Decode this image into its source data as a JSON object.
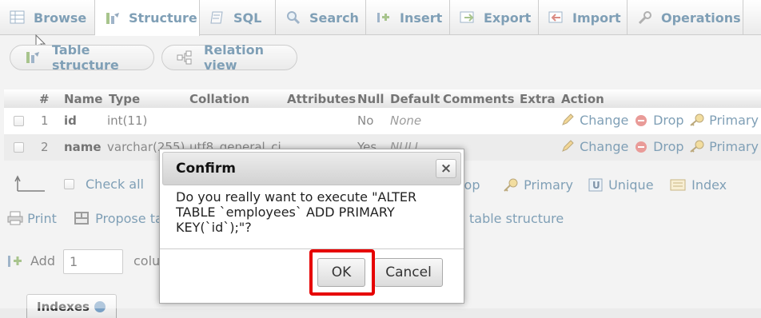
{
  "tabs": [
    {
      "label": "Browse",
      "icon": "browse-icon"
    },
    {
      "label": "Structure",
      "icon": "structure-icon",
      "active": true
    },
    {
      "label": "SQL",
      "icon": "sql-icon"
    },
    {
      "label": "Search",
      "icon": "search-icon"
    },
    {
      "label": "Insert",
      "icon": "insert-icon"
    },
    {
      "label": "Export",
      "icon": "export-icon"
    },
    {
      "label": "Import",
      "icon": "import-icon"
    },
    {
      "label": "Operations",
      "icon": "wrench-icon"
    }
  ],
  "subtabs": {
    "table_structure": "Table structure",
    "relation_view": "Relation view"
  },
  "columns": [
    "#",
    "Name",
    "Type",
    "Collation",
    "Attributes",
    "Null",
    "Default",
    "Comments",
    "Extra",
    "Action"
  ],
  "rows": [
    {
      "num": "1",
      "name": "id",
      "type": "int(11)",
      "collation": "",
      "null": "No",
      "default": "None"
    },
    {
      "num": "2",
      "name": "name",
      "type": "varchar(255)",
      "collation": "utf8_general_ci",
      "null": "Yes",
      "default": "NULL"
    }
  ],
  "row_actions": {
    "change": "Change",
    "drop": "Drop",
    "primary": "Primary"
  },
  "bulk": {
    "check_all": "Check all",
    "drop": "Drop",
    "primary": "Primary",
    "unique": "Unique",
    "index": "Index"
  },
  "bottom_links": {
    "print": "Print",
    "propose": "Propose table structure",
    "track": "table structure"
  },
  "add": {
    "label": "Add",
    "value": "1",
    "suffix": "column(s)"
  },
  "indexes_label": "Indexes",
  "dialog": {
    "title": "Confirm",
    "message": "Do you really want to execute \"ALTER TABLE `employees` ADD PRIMARY KEY(`id`);\"?",
    "ok": "OK",
    "cancel": "Cancel",
    "close_symbol": "×"
  },
  "colors": {
    "link": "#235a81",
    "highlight": "#e60000",
    "drop": "#d9534f"
  }
}
